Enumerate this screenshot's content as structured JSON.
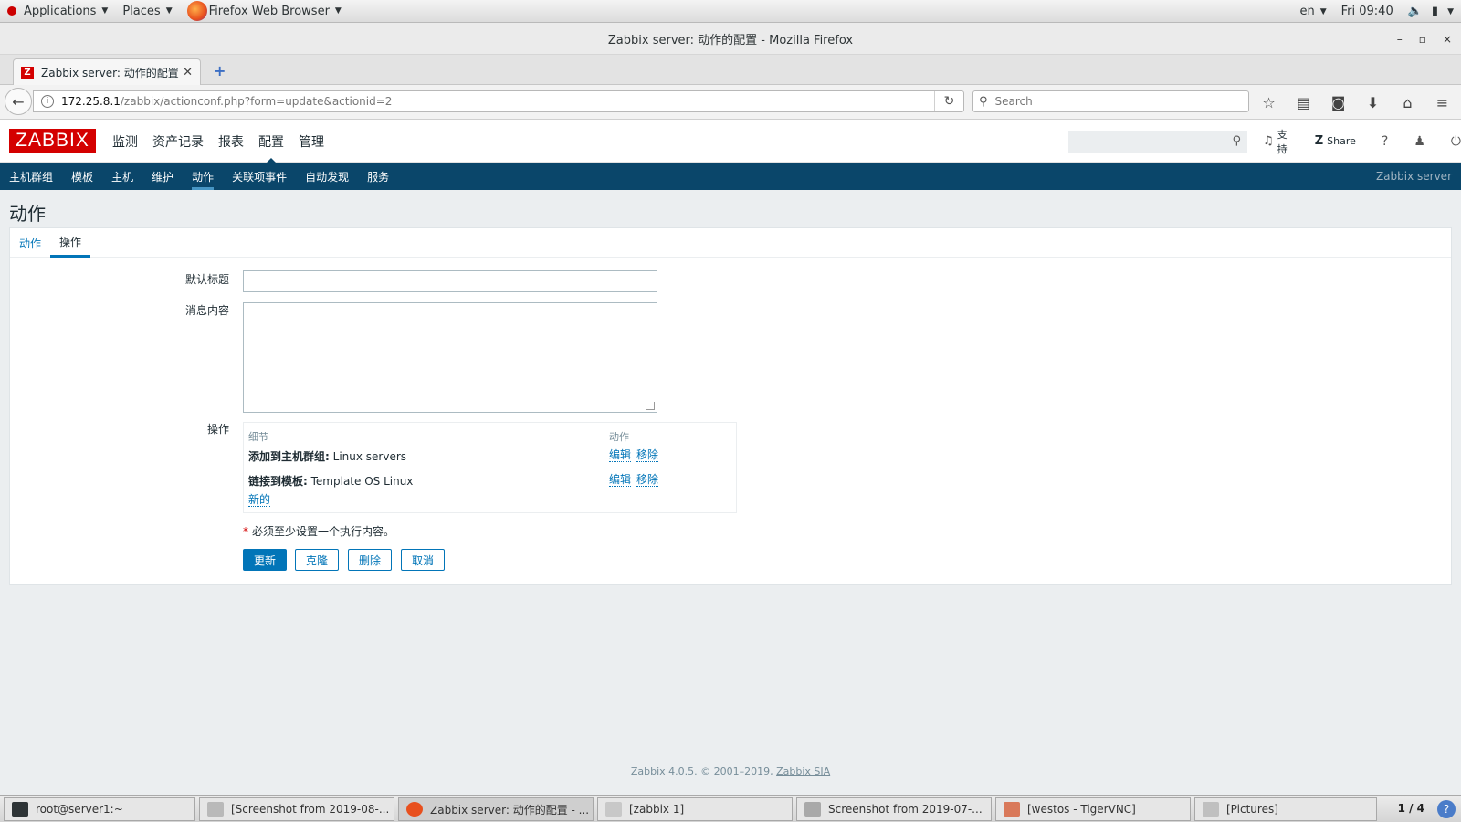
{
  "gnome": {
    "applications": "Applications",
    "places": "Places",
    "browser_app": "Firefox Web Browser",
    "lang": "en",
    "clock": "Fri 09:40"
  },
  "window": {
    "title": "Zabbix server: 动作的配置 - Mozilla Firefox",
    "minimize": "–",
    "maximize": "▫",
    "close": "×"
  },
  "browser": {
    "tab_title": "Zabbix server: 动作的配置",
    "url_host": "172.25.8.1",
    "url_path": "/zabbix/actionconf.php?form=update&actionid=2",
    "search_placeholder": "Search"
  },
  "zabbix": {
    "logo": "ZABBIX",
    "top_menu": [
      "监测",
      "资产记录",
      "报表",
      "配置",
      "管理"
    ],
    "active_top": "配置",
    "support": "支持",
    "share": "Share",
    "help": "?",
    "sub_menu": [
      "主机群组",
      "模板",
      "主机",
      "维护",
      "动作",
      "关联项事件",
      "自动发现",
      "服务"
    ],
    "server_name": "Zabbix server"
  },
  "page": {
    "title": "动作",
    "tabs": [
      "动作",
      "操作"
    ],
    "labels": {
      "default_subject": "默认标题",
      "default_message": "消息内容",
      "operations": "操作"
    },
    "ops_headers": {
      "details": "细节",
      "action": "动作"
    },
    "operations": [
      {
        "label": "添加到主机群组:",
        "value": " Linux servers",
        "edit": "编辑",
        "remove": "移除"
      },
      {
        "label": "链接到模板:",
        "value": " Template OS Linux",
        "edit": "编辑",
        "remove": "移除"
      }
    ],
    "new_link": "新的",
    "required_note": "必须至少设置一个执行内容。",
    "buttons": {
      "update": "更新",
      "clone": "克隆",
      "delete": "删除",
      "cancel": "取消"
    }
  },
  "footer": {
    "text": "Zabbix 4.0.5. © 2001–2019, ",
    "link": "Zabbix SIA"
  },
  "taskbar": {
    "tasks": [
      "root@server1:~",
      "[Screenshot from 2019-08-...",
      "Zabbix server: 动作的配置 - ...",
      "[zabbix 1]",
      "Screenshot from 2019-07-...",
      "[westos - TigerVNC]",
      "[Pictures]"
    ],
    "pager": "1 / 4"
  },
  "colors": {
    "zabbix_red": "#d40000",
    "nav_blue": "#0a466a",
    "link_blue": "#0275b8"
  }
}
